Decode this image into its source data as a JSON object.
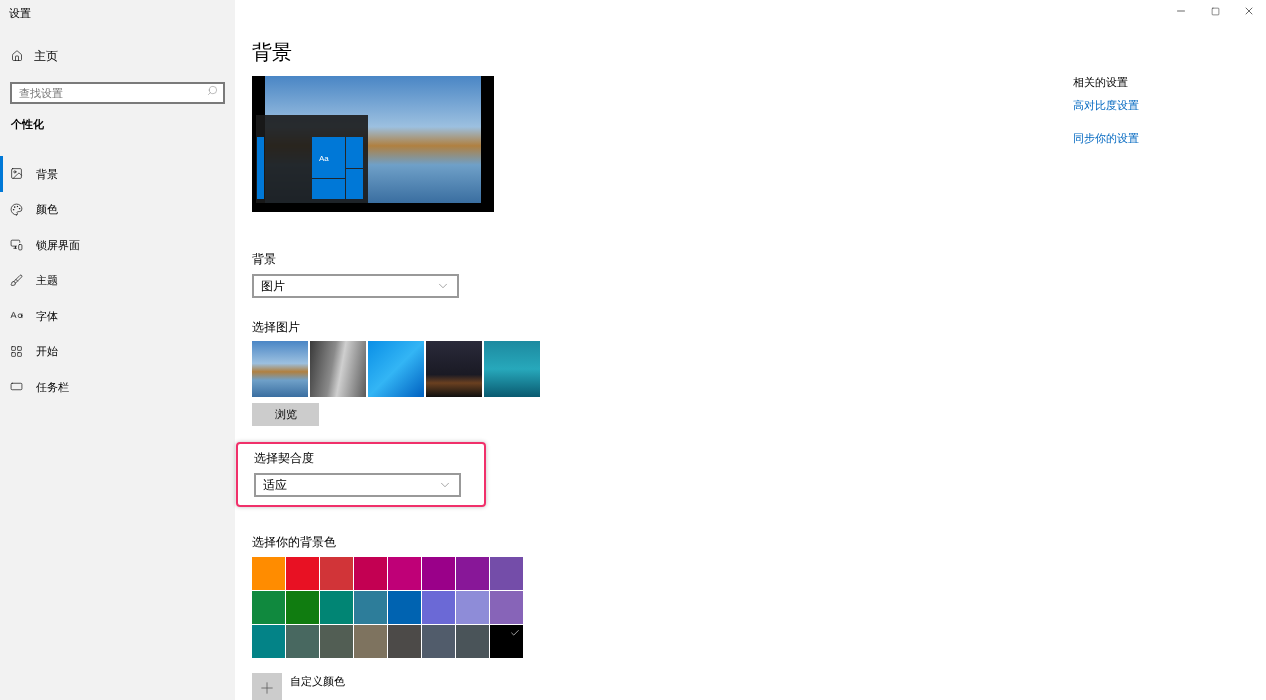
{
  "window": {
    "title": "设置"
  },
  "sidebar": {
    "home": "主页",
    "search": {
      "placeholder": "查找设置"
    },
    "section": "个性化",
    "items": [
      {
        "label": "背景",
        "kind": "picture",
        "selected": true
      },
      {
        "label": "颜色",
        "kind": "palette",
        "selected": false
      },
      {
        "label": "锁屏界面",
        "kind": "lock",
        "selected": false
      },
      {
        "label": "主题",
        "kind": "theme",
        "selected": false
      },
      {
        "label": "字体",
        "kind": "font",
        "selected": false
      },
      {
        "label": "开始",
        "kind": "start",
        "selected": false
      },
      {
        "label": "任务栏",
        "kind": "taskbar",
        "selected": false
      }
    ]
  },
  "page": {
    "title": "背景",
    "preview": {
      "tile_label": "Aa"
    },
    "background": {
      "label": "背景",
      "value": "图片"
    },
    "choose_picture": {
      "label": "选择图片",
      "pictures": [
        {
          "kind": "beach"
        },
        {
          "kind": "rock"
        },
        {
          "kind": "windows"
        },
        {
          "kind": "night"
        },
        {
          "kind": "underwater"
        }
      ],
      "browse": "浏览"
    },
    "fit": {
      "label": "选择契合度",
      "value": "适应",
      "highlighted": true
    },
    "colors": {
      "label": "选择你的背景色",
      "swatches": [
        {
          "color": "#ff8c00",
          "selected": false
        },
        {
          "color": "#e81123",
          "selected": false
        },
        {
          "color": "#d13438",
          "selected": false
        },
        {
          "color": "#c30052",
          "selected": false
        },
        {
          "color": "#bf0077",
          "selected": false
        },
        {
          "color": "#9a0089",
          "selected": false
        },
        {
          "color": "#881798",
          "selected": false
        },
        {
          "color": "#744da9",
          "selected": false
        },
        {
          "color": "#10893e",
          "selected": false
        },
        {
          "color": "#107c10",
          "selected": false
        },
        {
          "color": "#018574",
          "selected": false
        },
        {
          "color": "#2d7d9a",
          "selected": false
        },
        {
          "color": "#0063b1",
          "selected": false
        },
        {
          "color": "#6b69d6",
          "selected": false
        },
        {
          "color": "#8e8cd8",
          "selected": false
        },
        {
          "color": "#8764b8",
          "selected": false
        },
        {
          "color": "#038387",
          "selected": false
        },
        {
          "color": "#486860",
          "selected": false
        },
        {
          "color": "#525e54",
          "selected": false
        },
        {
          "color": "#7e735f",
          "selected": false
        },
        {
          "color": "#4c4a48",
          "selected": false
        },
        {
          "color": "#515c6b",
          "selected": false
        },
        {
          "color": "#4a5459",
          "selected": false
        },
        {
          "color": "#000000",
          "selected": true
        }
      ],
      "custom": "自定义颜色"
    }
  },
  "related": {
    "title": "相关的设置",
    "links": [
      "高对比度设置",
      "同步你的设置"
    ]
  }
}
